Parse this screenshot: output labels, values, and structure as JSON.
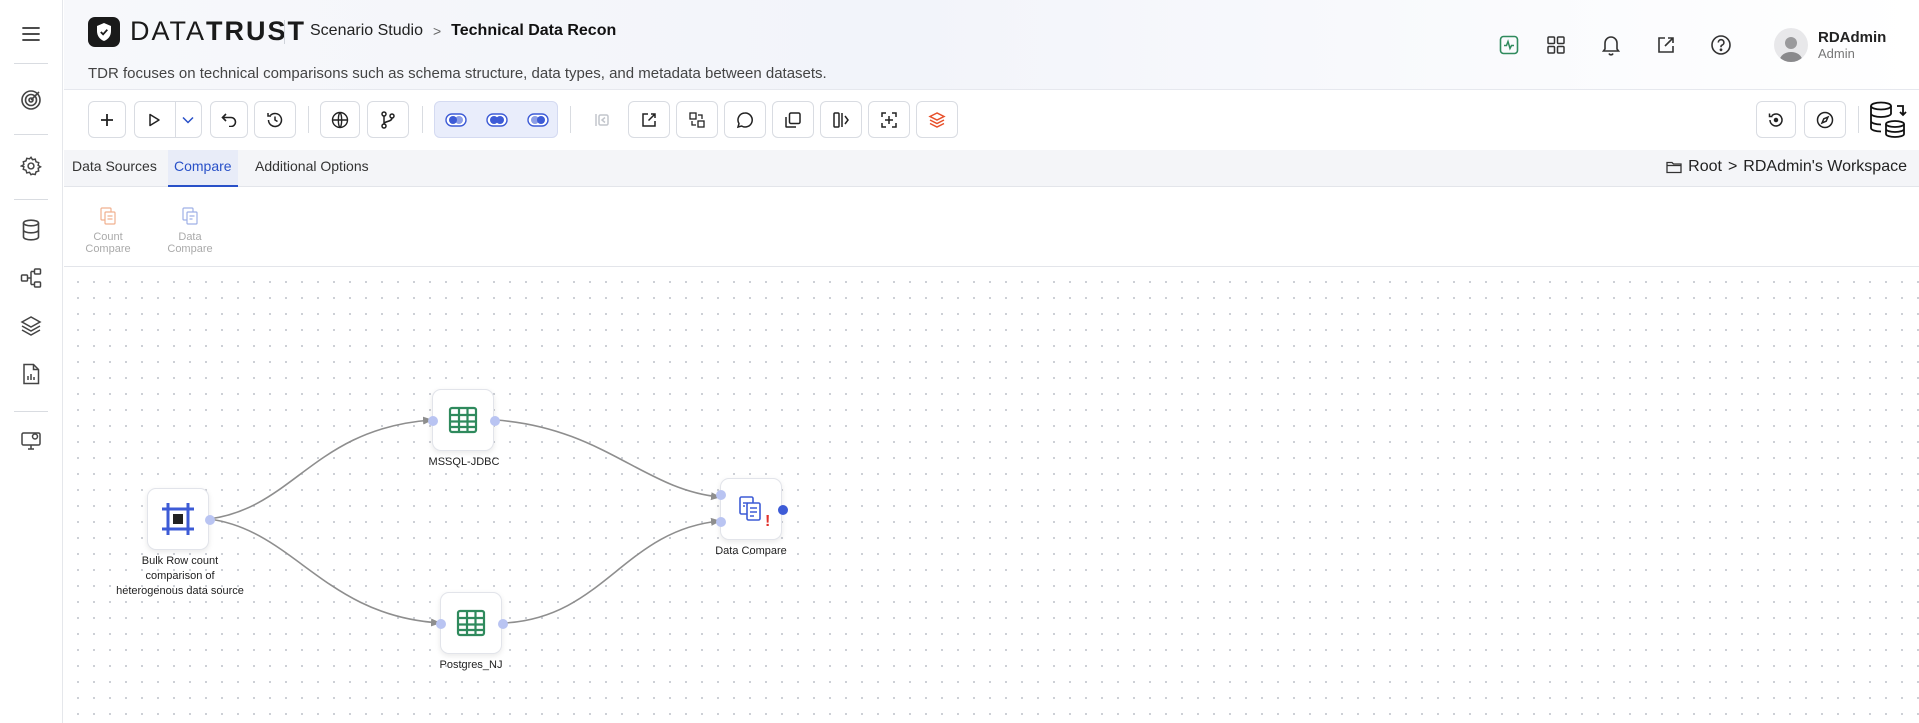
{
  "app": {
    "brand_part1": "DATA",
    "brand_part2": "TRUST",
    "breadcrumb_parent": "Scenario Studio",
    "breadcrumb_separator": ">",
    "breadcrumb_current": "Technical Data Recon",
    "description": "TDR focuses on technical comparisons such as schema structure, data types, and metadata between datasets."
  },
  "user": {
    "name": "RDAdmin",
    "role": "Admin"
  },
  "tabs": [
    {
      "label": "Data Sources",
      "active": false
    },
    {
      "label": "Compare",
      "active": true
    },
    {
      "label": "Additional Options",
      "active": false
    }
  ],
  "workspace_path": {
    "root": "Root",
    "separator": ">",
    "workspace": "RDAdmin's Workspace"
  },
  "palette": [
    {
      "line1": "Count",
      "line2": "Compare"
    },
    {
      "line1": "Data",
      "line2": "Compare"
    }
  ],
  "nodes": {
    "source": {
      "label": "Bulk Row count comparison of heterogenous data source"
    },
    "mssql": {
      "label": "MSSQL-JDBC"
    },
    "postgres": {
      "label": "Postgres_NJ"
    },
    "compare": {
      "label": "Data Compare",
      "warning": "!"
    }
  },
  "colors": {
    "accent": "#2850c8",
    "table_icon": "#2f8a5d",
    "node_icon_blue": "#3d5bd6",
    "warning": "#e0302a",
    "edge": "#8e8e8e"
  },
  "icons": {
    "sidebar": [
      "hamburger-icon",
      "target-icon",
      "gear-icon",
      "database-icon",
      "workflow-icon",
      "layers-icon",
      "report-icon",
      "monitor-icon"
    ],
    "header": [
      "activity-icon",
      "apps-grid-icon",
      "bell-icon",
      "external-link-icon",
      "help-icon"
    ]
  }
}
